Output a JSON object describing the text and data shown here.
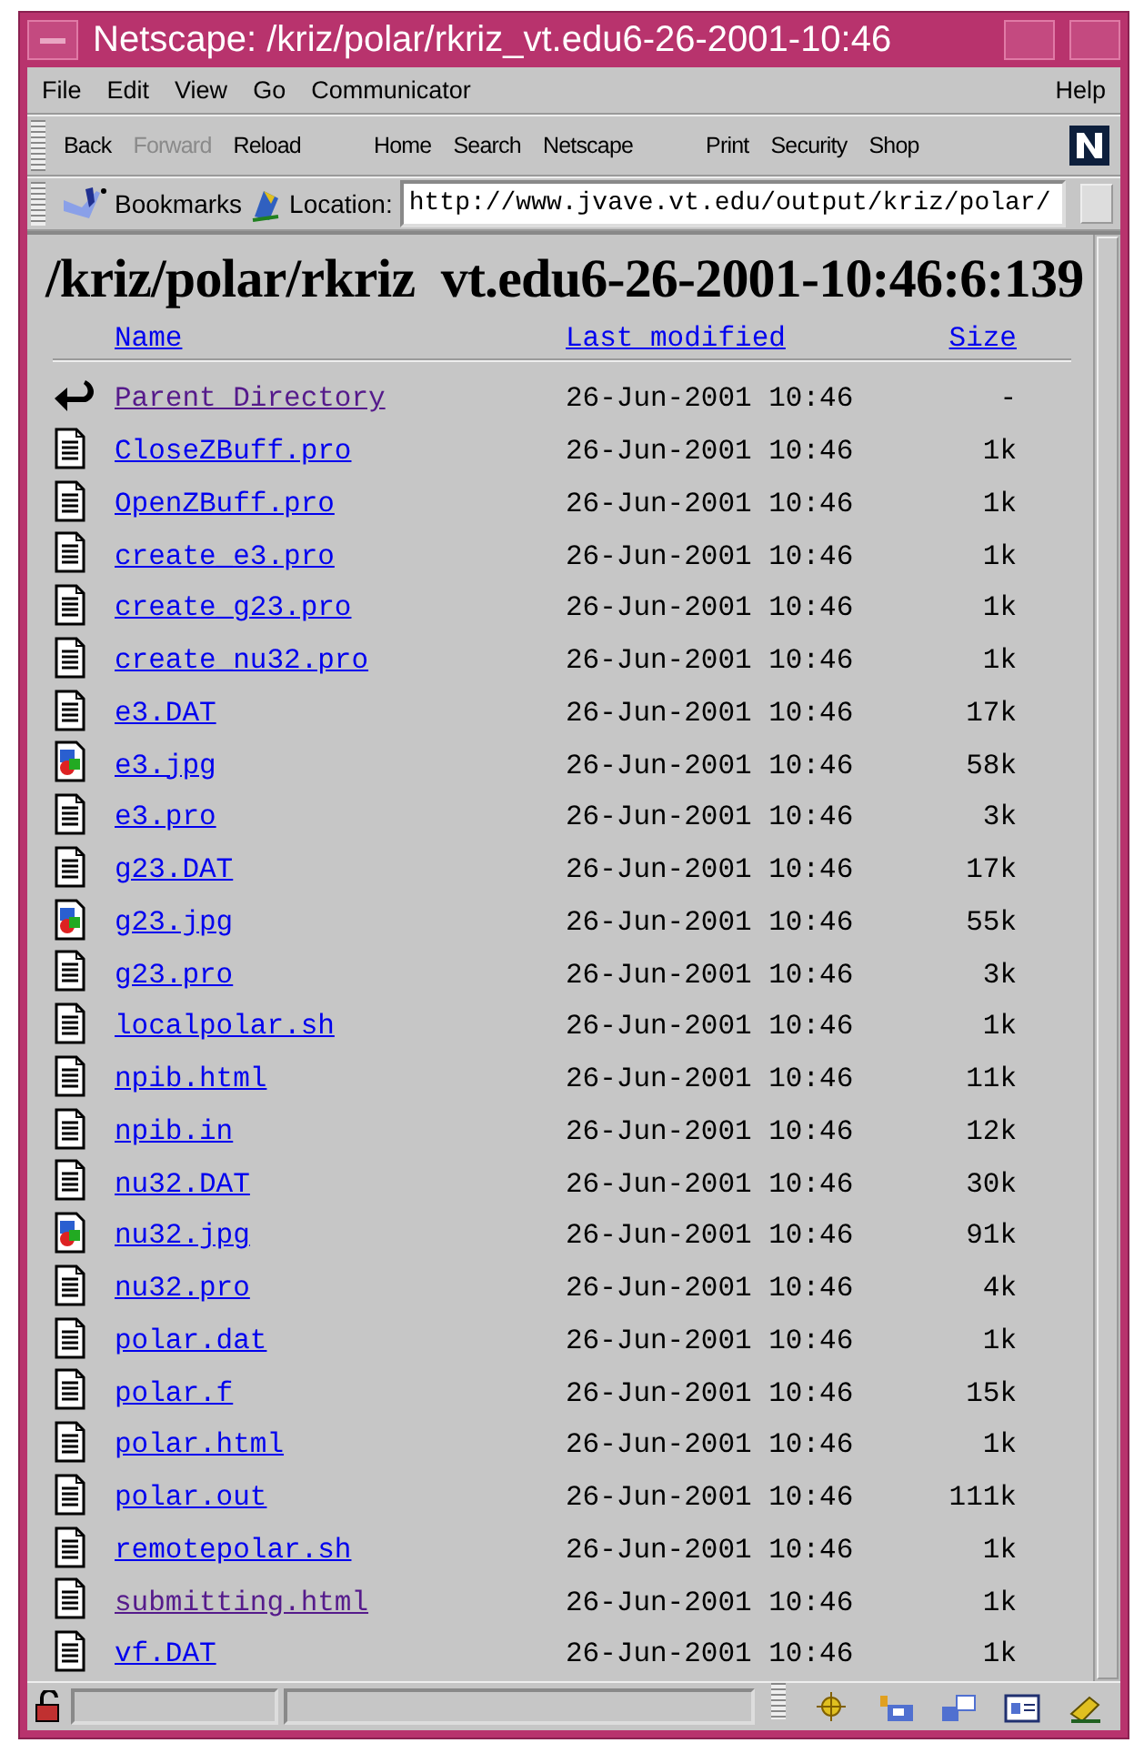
{
  "window": {
    "title": "Netscape: /kriz/polar/rkriz_vt.edu6-26-2001-10:46"
  },
  "menu": [
    {
      "label": "File"
    },
    {
      "label": "Edit"
    },
    {
      "label": "View"
    },
    {
      "label": "Go"
    },
    {
      "label": "Communicator"
    },
    {
      "label": "Help"
    }
  ],
  "toolbar": [
    {
      "label": "Back",
      "disabled": false
    },
    {
      "label": "Forward",
      "disabled": true
    },
    {
      "label": "Reload",
      "disabled": false
    },
    {
      "label": "Home",
      "disabled": false
    },
    {
      "label": "Search",
      "disabled": false
    },
    {
      "label": "Netscape",
      "disabled": false
    },
    {
      "label": "Print",
      "disabled": false
    },
    {
      "label": "Security",
      "disabled": false
    },
    {
      "label": "Shop",
      "disabled": false
    }
  ],
  "location_bar": {
    "bookmarks": "Bookmarks",
    "label": "Location:",
    "value": "http://www.jvave.vt.edu/output/kriz/polar/"
  },
  "page": {
    "heading": "/kriz/polar/rkriz  vt.edu6-26-2001-10:46:6:139",
    "columns": [
      "Name",
      "Last modified",
      "Size"
    ],
    "rows": [
      {
        "kind": "parent",
        "name": "Parent Directory",
        "modified": "26-Jun-2001 10:46",
        "size": "-",
        "visited": true
      },
      {
        "kind": "text",
        "name": "CloseZBuff.pro",
        "modified": "26-Jun-2001 10:46",
        "size": "1k",
        "visited": false
      },
      {
        "kind": "text",
        "name": "OpenZBuff.pro",
        "modified": "26-Jun-2001 10:46",
        "size": "1k",
        "visited": false
      },
      {
        "kind": "text",
        "name": "create_e3.pro",
        "modified": "26-Jun-2001 10:46",
        "size": "1k",
        "visited": false
      },
      {
        "kind": "text",
        "name": "create_g23.pro",
        "modified": "26-Jun-2001 10:46",
        "size": "1k",
        "visited": false
      },
      {
        "kind": "text",
        "name": "create_nu32.pro",
        "modified": "26-Jun-2001 10:46",
        "size": "1k",
        "visited": false
      },
      {
        "kind": "text",
        "name": "e3.DAT",
        "modified": "26-Jun-2001 10:46",
        "size": "17k",
        "visited": false
      },
      {
        "kind": "image",
        "name": "e3.jpg",
        "modified": "26-Jun-2001 10:46",
        "size": "58k",
        "visited": false
      },
      {
        "kind": "text",
        "name": "e3.pro",
        "modified": "26-Jun-2001 10:46",
        "size": "3k",
        "visited": false
      },
      {
        "kind": "text",
        "name": "g23.DAT",
        "modified": "26-Jun-2001 10:46",
        "size": "17k",
        "visited": false
      },
      {
        "kind": "image",
        "name": "g23.jpg",
        "modified": "26-Jun-2001 10:46",
        "size": "55k",
        "visited": false
      },
      {
        "kind": "text",
        "name": "g23.pro",
        "modified": "26-Jun-2001 10:46",
        "size": "3k",
        "visited": false
      },
      {
        "kind": "text",
        "name": "localpolar.sh",
        "modified": "26-Jun-2001 10:46",
        "size": "1k",
        "visited": false
      },
      {
        "kind": "text",
        "name": "npib.html",
        "modified": "26-Jun-2001 10:46",
        "size": "11k",
        "visited": false
      },
      {
        "kind": "text",
        "name": "npib.in",
        "modified": "26-Jun-2001 10:46",
        "size": "12k",
        "visited": false
      },
      {
        "kind": "text",
        "name": "nu32.DAT",
        "modified": "26-Jun-2001 10:46",
        "size": "30k",
        "visited": false
      },
      {
        "kind": "image",
        "name": "nu32.jpg",
        "modified": "26-Jun-2001 10:46",
        "size": "91k",
        "visited": false
      },
      {
        "kind": "text",
        "name": "nu32.pro",
        "modified": "26-Jun-2001 10:46",
        "size": "4k",
        "visited": false
      },
      {
        "kind": "text",
        "name": "polar.dat",
        "modified": "26-Jun-2001 10:46",
        "size": "1k",
        "visited": false
      },
      {
        "kind": "text",
        "name": "polar.f",
        "modified": "26-Jun-2001 10:46",
        "size": "15k",
        "visited": false
      },
      {
        "kind": "text",
        "name": "polar.html",
        "modified": "26-Jun-2001 10:46",
        "size": "1k",
        "visited": false
      },
      {
        "kind": "text",
        "name": "polar.out",
        "modified": "26-Jun-2001 10:46",
        "size": "111k",
        "visited": false
      },
      {
        "kind": "text",
        "name": "remotepolar.sh",
        "modified": "26-Jun-2001 10:46",
        "size": "1k",
        "visited": false
      },
      {
        "kind": "text",
        "name": "submitting.html",
        "modified": "26-Jun-2001 10:46",
        "size": "1k",
        "visited": true
      },
      {
        "kind": "text",
        "name": "vf.DAT",
        "modified": "26-Jun-2001 10:46",
        "size": "1k",
        "visited": false
      }
    ]
  }
}
